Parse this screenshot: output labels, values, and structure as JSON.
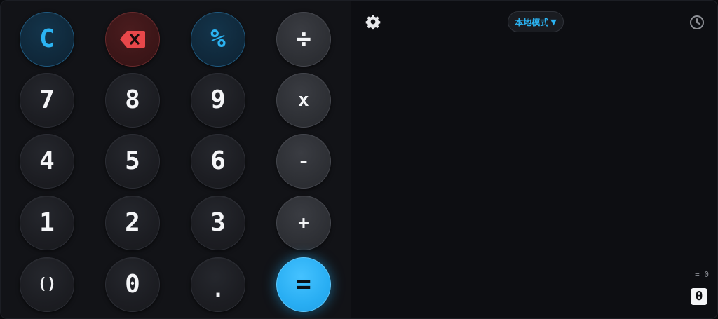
{
  "keys": {
    "clear": "C",
    "percent": "%",
    "divide": "÷",
    "seven": "7",
    "eight": "8",
    "nine": "9",
    "multiply": "x",
    "four": "4",
    "five": "5",
    "six": "6",
    "minus": "-",
    "one": "1",
    "two": "2",
    "three": "3",
    "plus": "+",
    "parens": "()",
    "zero": "0",
    "dot": ".",
    "equals": "="
  },
  "header": {
    "mode_label": "本地模式",
    "mode_arrow": "▼"
  },
  "display": {
    "expression": "= 0",
    "result": "0"
  },
  "colors": {
    "accent": "#2bb3f2",
    "delete": "#e8474a"
  },
  "icons": {
    "settings": "gear-icon",
    "history": "clock-icon",
    "backspace": "backspace-icon"
  }
}
